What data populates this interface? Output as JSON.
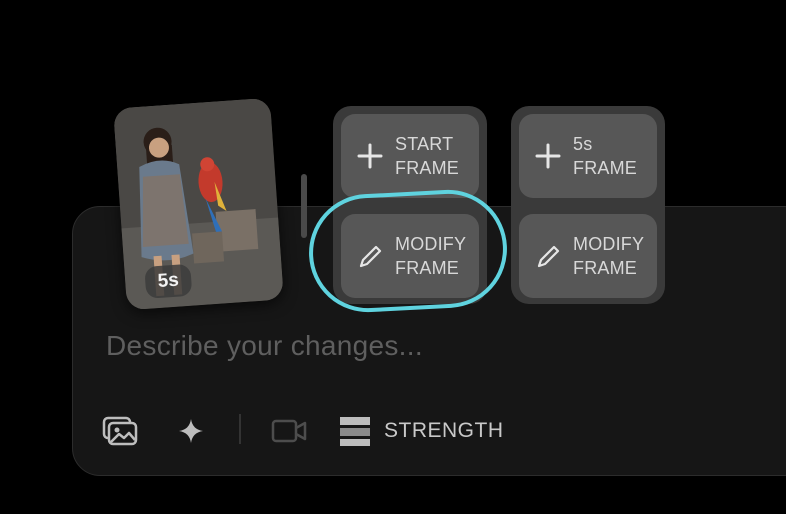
{
  "thumbnail": {
    "duration_badge": "5s"
  },
  "frame_buttons": {
    "start_frame": "START\nFRAME",
    "modify_frame_1": "MODIFY\nFRAME",
    "five_s_frame": "5s\nFRAME",
    "modify_frame_2": "MODIFY\nFRAME"
  },
  "composer": {
    "placeholder": "Describe your changes..."
  },
  "toolbar": {
    "strength_label": "STRENGTH"
  },
  "colors": {
    "highlight": "#5fd3df",
    "background": "#000000",
    "button": "#575757"
  },
  "icons": [
    "gallery-icon",
    "sparkle-icon",
    "video-camera-icon",
    "strength-icon",
    "plus-icon",
    "pencil-icon"
  ]
}
